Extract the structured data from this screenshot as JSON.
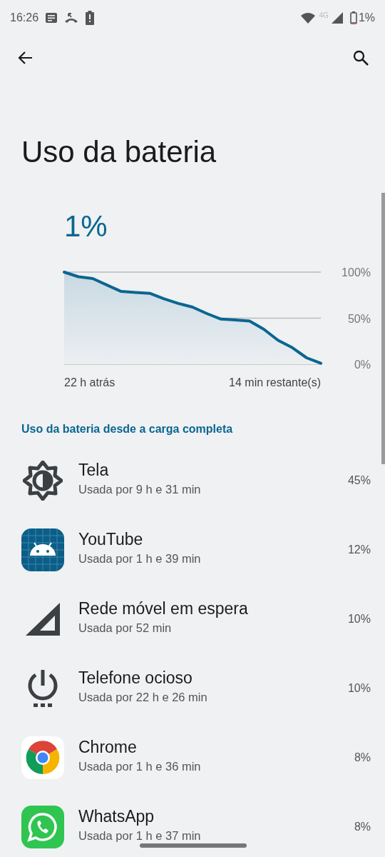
{
  "status_bar": {
    "time": "16:26",
    "network": "4G",
    "battery": "1%"
  },
  "title": "Uso da bateria",
  "battery_level": "1%",
  "chart": {
    "y_labels": [
      "100%",
      "50%",
      "0%"
    ],
    "start_label": "22 h atrás",
    "end_label": "14 min restante(s)"
  },
  "section_header": "Uso da bateria desde a carga completa",
  "items": [
    {
      "name": "Tela",
      "usage": "Usada por 9 h e 31 min",
      "percent": "45%"
    },
    {
      "name": "YouTube",
      "usage": "Usada por 1 h e 39 min",
      "percent": "12%"
    },
    {
      "name": "Rede móvel em espera",
      "usage": "Usada por 52 min",
      "percent": "10%"
    },
    {
      "name": "Telefone ocioso",
      "usage": "Usada por 22 h e 26 min",
      "percent": "10%"
    },
    {
      "name": "Chrome",
      "usage": "Usada por 1 h e 36 min",
      "percent": "8%"
    },
    {
      "name": "WhatsApp",
      "usage": "Usada por 1 h e 37 min",
      "percent": "8%"
    }
  ]
}
